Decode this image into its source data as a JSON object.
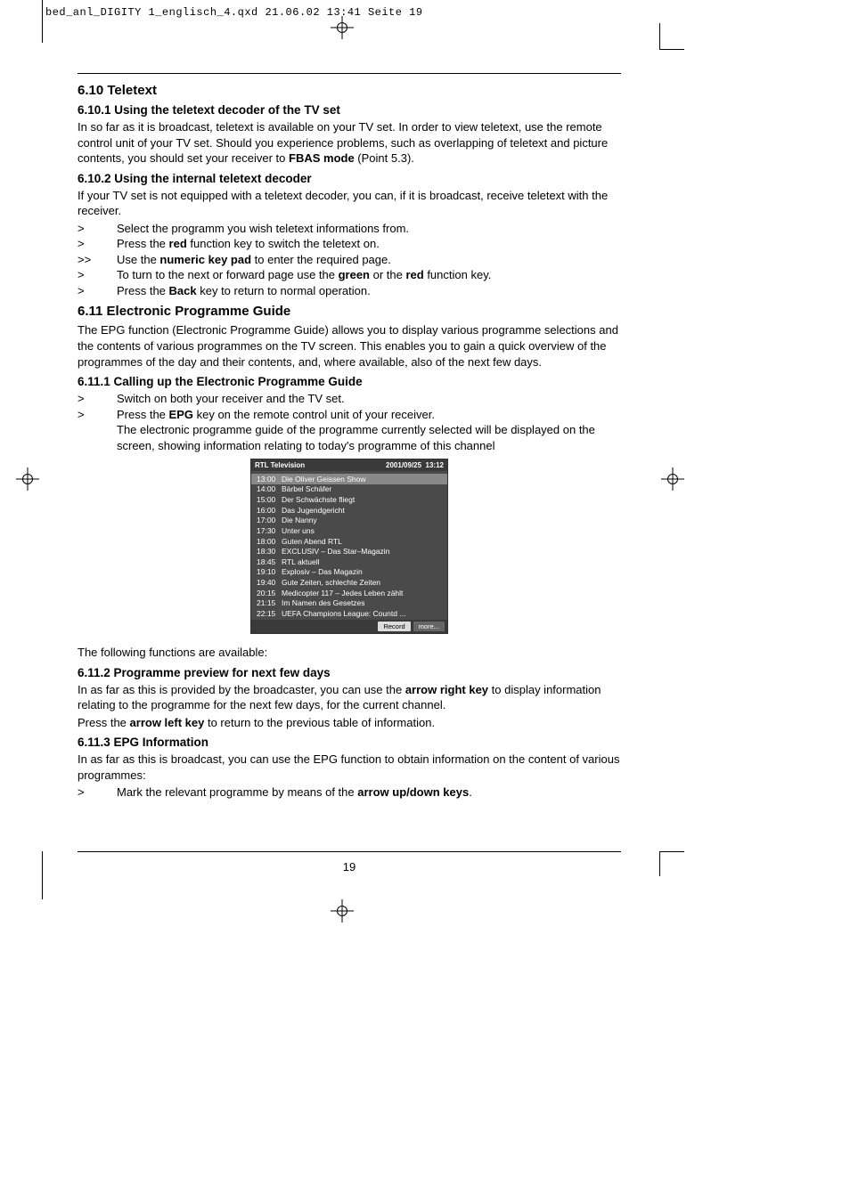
{
  "header": "bed_anl_DIGITY 1_englisch_4.qxd  21.06.02  13:41  Seite 19",
  "s610": {
    "title": "6.10 Teletext",
    "s1": {
      "title": "6.10.1 Using the teletext decoder of the TV set",
      "p1a": "In so far as it is broadcast, teletext is available on your TV set. In order to view teletext, use the remote control unit of your TV set. Should you experience problems, such as overlapping of teletext and picture contents, you should set your receiver to ",
      "p1b": "FBAS mode",
      "p1c": " (Point 5.3)."
    },
    "s2": {
      "title": "6.10.2 Using the internal teletext decoder",
      "p1": "If your TV set is not equipped with a teletext decoder, you can, if it is broadcast, receive teletext with the receiver.",
      "b1": "Select the programm you wish teletext informations from.",
      "b2a": "Press the ",
      "b2b": "red",
      "b2c": " function key to switch the teletext on.",
      "b3a": "Use the ",
      "b3b": "numeric key pad",
      "b3c": " to enter the required page.",
      "b4a": "To turn to the next or forward page use the ",
      "b4b": "green",
      "b4c": " or the ",
      "b4d": "red",
      "b4e": " function key.",
      "b5a": "Press the ",
      "b5b": "Back",
      "b5c": " key to return to normal operation."
    }
  },
  "s611": {
    "title": "6.11 Electronic Programme Guide",
    "p1": "The EPG function (Electronic Programme Guide) allows you to display various programme selections and the contents of various programmes on the TV screen. This enables you to gain a quick overview of the programmes of the day and their contents, and, where available, also of the next few days.",
    "s1": {
      "title": "6.11.1 Calling up the Electronic Programme Guide",
      "b1": "Switch on both your receiver and the TV set.",
      "b2a": "Press the ",
      "b2b": "EPG",
      "b2c": " key on the remote control unit of your receiver.",
      "b2d": "The electronic programme guide of the programme currently selected will be displayed on the screen, showing information relating to today's programme of this channel"
    },
    "after_img": "The following functions are available:",
    "s2": {
      "title": "6.11.2 Programme preview for next few days",
      "p1a": "In as far as this is provided by the broadcaster, you can use the ",
      "p1b": "arrow right key",
      "p1c": " to display information relating to the programme for the next few days, for the current channel.",
      "p2a": "Press the ",
      "p2b": "arrow left key",
      "p2c": " to return to the previous table of information."
    },
    "s3": {
      "title": "6.11.3 EPG Information",
      "p1": "In as far as this is broadcast, you can use the EPG function to obtain information on the content of various programmes:",
      "b1a": "Mark the relevant programme by means of the ",
      "b1b": "arrow up/down keys",
      "b1c": "."
    }
  },
  "epg": {
    "channel": "RTL Television",
    "date": "2001/09/25",
    "time": "13:12",
    "rows": [
      {
        "t": "13:00",
        "p": "Die Oliver Geissen Show",
        "hl": true
      },
      {
        "t": "14:00",
        "p": "Bärbel Schäfer"
      },
      {
        "t": "15:00",
        "p": "Der Schwächste fliegt"
      },
      {
        "t": "16:00",
        "p": "Das Jugendgericht"
      },
      {
        "t": "17:00",
        "p": "Die Nanny"
      },
      {
        "t": "17:30",
        "p": "Unter uns"
      },
      {
        "t": "18:00",
        "p": "Guten Abend RTL"
      },
      {
        "t": "18:30",
        "p": "EXCLUSIV – Das Star–Magazin"
      },
      {
        "t": "18:45",
        "p": "RTL aktuell"
      },
      {
        "t": "19:10",
        "p": "Explosiv – Das Magazin"
      },
      {
        "t": "19:40",
        "p": "Gute Zeiten, schlechte Zeiten"
      },
      {
        "t": "20:15",
        "p": "Medicopter 117 – Jedes Leben zählt"
      },
      {
        "t": "21:15",
        "p": "Im Namen des Gesetzes"
      },
      {
        "t": "22:15",
        "p": "UEFA Champions League: Countd ..."
      }
    ],
    "btn_record": "Record",
    "btn_more": "more..."
  },
  "page_num": "19"
}
